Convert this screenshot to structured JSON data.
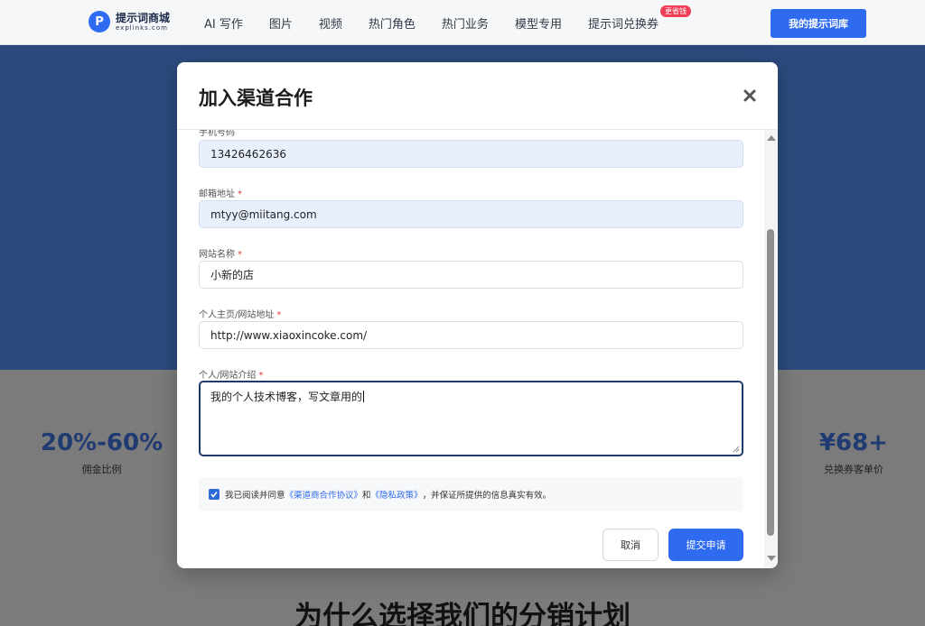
{
  "nav": {
    "logo_mark": "P",
    "logo_main": "提示词商城",
    "logo_sub": "explinks.com",
    "items": [
      "AI 写作",
      "图片",
      "视频",
      "热门角色",
      "热门业务",
      "模型专用",
      "提示词兑换券"
    ],
    "badge": "更省钱",
    "cta": "我的提示词库"
  },
  "stats": {
    "left_value": "20%-60%",
    "left_label": "佣金比例",
    "right_value": "¥68+",
    "right_label": "兑换券客单价"
  },
  "section_title": "为什么选择我们的分销计划",
  "modal": {
    "title": "加入渠道合作",
    "fields": {
      "phone_label": "手机号码",
      "phone_value": "13426462636",
      "email_label": "邮箱地址",
      "email_value": "mtyy@miitang.com",
      "site_name_label": "网站名称",
      "site_name_value": "小新的店",
      "homepage_label": "个人主页/网站地址",
      "homepage_value": "http://www.xiaoxincoke.com/",
      "intro_label": "个人/网站介绍",
      "intro_value": "我的个人技术博客，写文章用的"
    },
    "required_mark": "*",
    "agreement": {
      "prefix": "我已阅读并同意",
      "link1": "《渠道商合作协议》",
      "and": "和",
      "link2": "《隐私政策》",
      "suffix": "，并保证所提供的信息真实有效。"
    },
    "cancel": "取消",
    "submit": "提交申请"
  },
  "colors": {
    "brand_blue": "#2f6bf0",
    "hero_dim": "#2b4a7c",
    "required_red": "#e03a3a"
  }
}
